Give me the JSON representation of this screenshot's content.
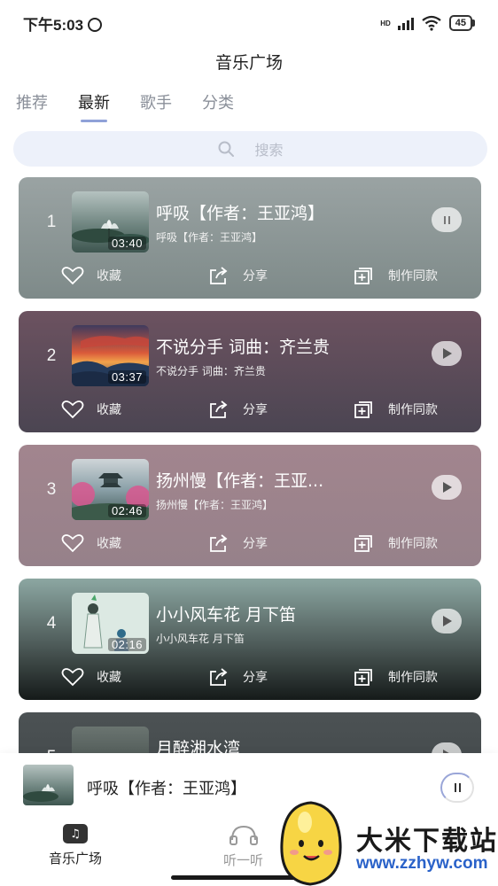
{
  "status_bar": {
    "time": "下午5:03",
    "battery": "45",
    "network": "HD"
  },
  "header": {
    "title": "音乐广场"
  },
  "tabs": [
    {
      "label": "推荐",
      "active": false
    },
    {
      "label": "最新",
      "active": true
    },
    {
      "label": "歌手",
      "active": false
    },
    {
      "label": "分类",
      "active": false
    }
  ],
  "search": {
    "placeholder": "搜索"
  },
  "songs": [
    {
      "index": "1",
      "title": "呼吸【作者：王亚鸿】",
      "subtitle": "呼吸【作者：王亚鸿】",
      "duration": "03:40",
      "state": "pause",
      "color": "#8a9595"
    },
    {
      "index": "2",
      "title": "不说分手 词曲：齐兰贵",
      "subtitle": "不说分手 词曲：齐兰贵",
      "duration": "03:37",
      "state": "play",
      "color": "#5e4a55"
    },
    {
      "index": "3",
      "title": "扬州慢【作者：王亚...",
      "subtitle": "扬州慢【作者：王亚鸿】",
      "duration": "02:46",
      "state": "play",
      "color": "#9c7f88"
    },
    {
      "index": "4",
      "title": "小小风车花 月下笛",
      "subtitle": "小小风车花 月下笛",
      "duration": "02:16",
      "state": "play",
      "color": "#6e8a86"
    },
    {
      "index": "5",
      "title": "月醉湘水湾",
      "subtitle": "",
      "duration": "",
      "state": "play",
      "color": "#4a4f52"
    }
  ],
  "actions": {
    "collect": "收藏",
    "share": "分享",
    "make_same": "制作同款"
  },
  "mini_player": {
    "title": "呼吸【作者：王亚鸿】"
  },
  "bottom_nav": [
    {
      "label": "音乐广场",
      "icon": "music-note-icon",
      "active": true
    },
    {
      "label": "听一听",
      "icon": "headphones-icon",
      "active": false
    }
  ],
  "watermark": {
    "name": "大米下载站",
    "url": "www.zzhyw.com"
  }
}
